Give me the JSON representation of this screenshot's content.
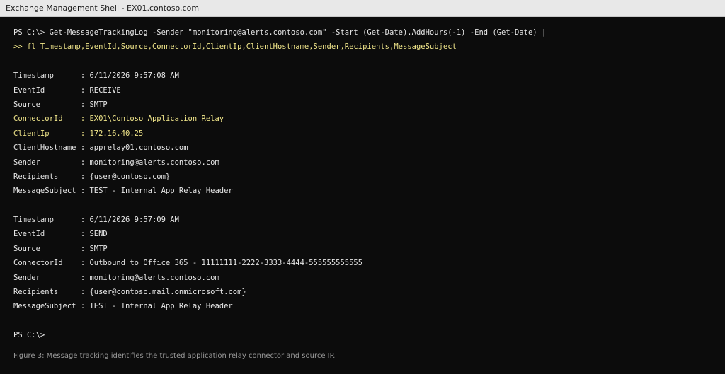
{
  "window": {
    "title": "Exchange Management Shell - EX01.contoso.com"
  },
  "console": {
    "command_line_1": "PS C:\\> Get-MessageTrackingLog -Sender \"monitoring@alerts.contoso.com\" -Start (Get-Date).AddHours(-1) -End (Get-Date) |",
    "command_line_2": ">> fl Timestamp,EventId,Source,ConnectorId,ClientIp,ClientHostname,Sender,Recipients,MessageSubject",
    "records": [
      {
        "timestamp": "Timestamp      : 6/11/2026 9:57:08 AM",
        "event_id": "EventId        : RECEIVE",
        "source": "Source         : SMTP",
        "connector_id": "ConnectorId    : EX01\\Contoso Application Relay",
        "client_ip": "ClientIp       : 172.16.40.25",
        "client_hostname": "ClientHostname : apprelay01.contoso.com",
        "sender": "Sender         : monitoring@alerts.contoso.com",
        "recipients": "Recipients     : {user@contoso.com}",
        "message_subject": "MessageSubject : TEST - Internal App Relay Header"
      },
      {
        "timestamp": "Timestamp      : 6/11/2026 9:57:09 AM",
        "event_id": "EventId        : SEND",
        "source": "Source         : SMTP",
        "connector_id": "ConnectorId    : Outbound to Office 365 - 11111111-2222-3333-4444-555555555555",
        "sender": "Sender         : monitoring@alerts.contoso.com",
        "recipients": "Recipients     : {user@contoso.mail.onmicrosoft.com}",
        "message_subject": "MessageSubject : TEST - Internal App Relay Header"
      }
    ],
    "prompt": "PS C:\\>"
  },
  "caption": "Figure 3: Message tracking identifies the trusted application relay connector and source IP.",
  "colors": {
    "background": "#0c0c0c",
    "text": "#e6e6e6",
    "highlight": "#f1e68a",
    "caption": "#9a9a9a",
    "titlebar": "#e8e8e8"
  }
}
